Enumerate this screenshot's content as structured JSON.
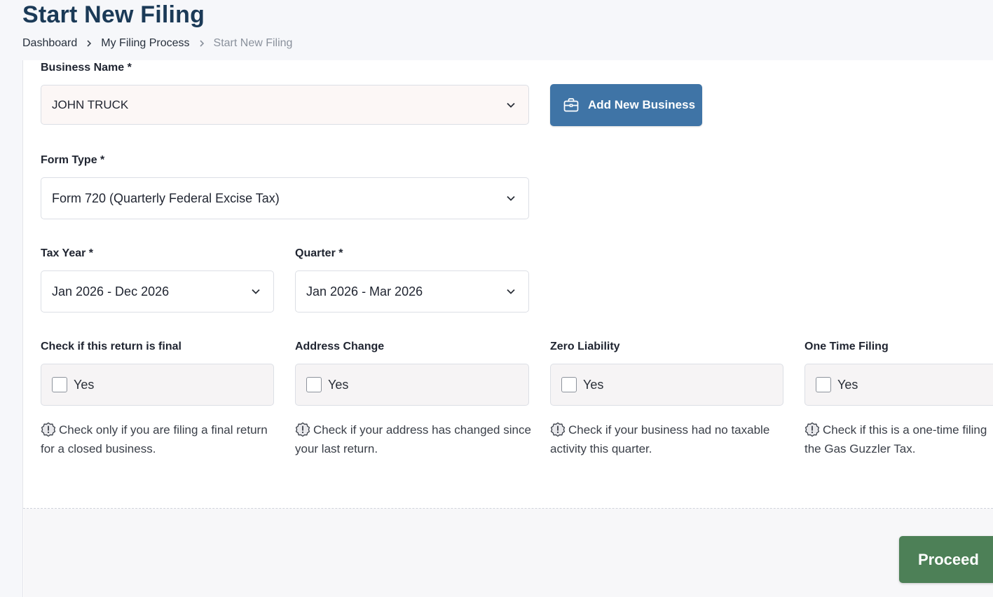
{
  "header": {
    "title": "Start New Filing",
    "breadcrumb": [
      "Dashboard",
      "My Filing Process",
      "Start New Filing"
    ]
  },
  "form": {
    "business": {
      "label": "Business Name *",
      "value": "JOHN TRUCK",
      "add_button": "Add New Business"
    },
    "form_type": {
      "label": "Form Type *",
      "value": "Form 720 (Quarterly Federal Excise Tax)"
    },
    "tax_year": {
      "label": "Tax Year *",
      "value": "Jan 2026 - Dec 2026"
    },
    "quarter": {
      "label": "Quarter *",
      "value": "Jan 2026 - Mar 2026"
    },
    "options": [
      {
        "label": "Check if this return is final",
        "checkbox": "Yes",
        "checked": false,
        "help": "Check only if you are filing a final return for a closed business."
      },
      {
        "label": "Address Change",
        "checkbox": "Yes",
        "checked": false,
        "help": "Check if your address has changed since your last return."
      },
      {
        "label": "Zero Liability",
        "checkbox": "Yes",
        "checked": false,
        "help": "Check if your business had no taxable activity this quarter."
      },
      {
        "label": "One Time Filing",
        "checkbox": "Yes",
        "checked": false,
        "help": "Check if this is a one-time filing the Gas Guzzler Tax."
      }
    ]
  },
  "footer": {
    "proceed_label": "Proceed"
  },
  "colors": {
    "title": "#1b3a57",
    "add_button": "#3f74a6",
    "proceed_button": "#4d8057"
  }
}
